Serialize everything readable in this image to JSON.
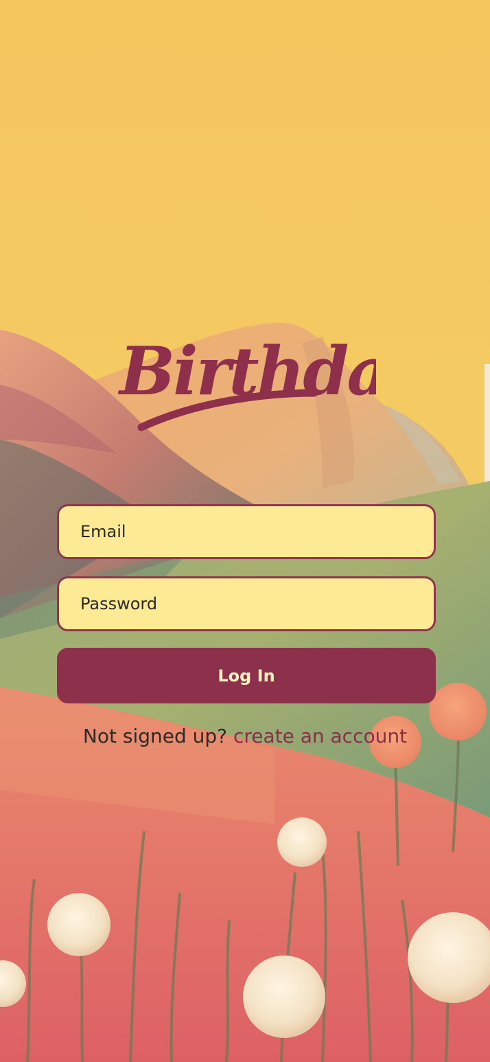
{
  "app": {
    "logo_text": "Birthdays"
  },
  "form": {
    "email_placeholder": "Email",
    "email_value": "",
    "password_placeholder": "Password",
    "password_value": "",
    "login_label": "Log In"
  },
  "signup": {
    "prompt": "Not signed up?",
    "link_label": "create an account"
  },
  "theme": {
    "brand": "#8c304b",
    "field_background": "#fcea95",
    "sky": "#f3c45e",
    "text": "#2c2a28"
  }
}
